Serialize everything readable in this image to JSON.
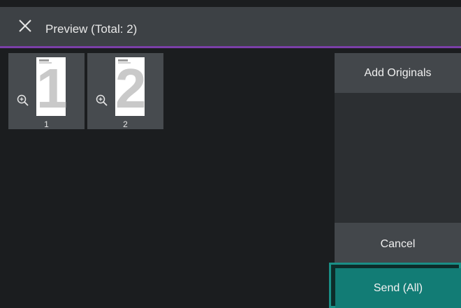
{
  "header": {
    "title": "Preview (Total: 2)",
    "close_icon": "close-icon"
  },
  "thumbnails": [
    {
      "page_number": "1",
      "icon": "zoom-in-icon"
    },
    {
      "page_number": "2",
      "icon": "zoom-in-icon"
    }
  ],
  "actions": {
    "add_originals": "Add Originals",
    "cancel": "Cancel",
    "send_all": "Send (All)"
  },
  "colors": {
    "header_bg": "#3d4145",
    "accent": "#7b3fa7",
    "send_bg": "#127c75",
    "background": "#1b1d1f"
  }
}
